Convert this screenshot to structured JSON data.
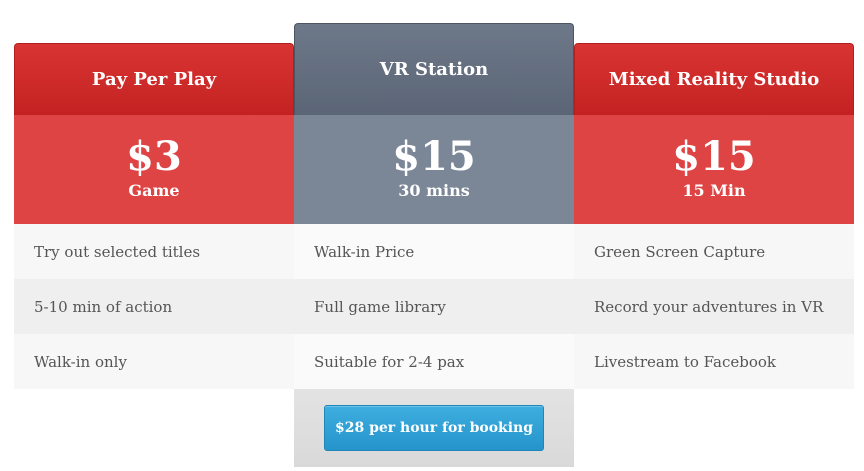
{
  "plans": [
    {
      "title": "Pay Per Play",
      "price": "$3",
      "unit": "Game",
      "features": [
        "Try out selected titles",
        "5-10 min of action",
        "Walk-in only"
      ]
    },
    {
      "title": "VR Station",
      "price": "$15",
      "unit": "30 mins",
      "features": [
        "Walk-in Price",
        "Full game library",
        "Suitable for 2-4 pax"
      ],
      "button": "$28 per hour for booking"
    },
    {
      "title": "Mixed Reality Studio",
      "price": "$15",
      "unit": "15 Min",
      "features": [
        "Green Screen Capture",
        "Record your adventures in VR",
        "Livestream to Facebook"
      ]
    }
  ],
  "colors": {
    "red_header": "#c42222",
    "red_price": "#de4444",
    "slate_header": "#5b6576",
    "slate_price": "#7b8696",
    "button": "#2594cb"
  }
}
